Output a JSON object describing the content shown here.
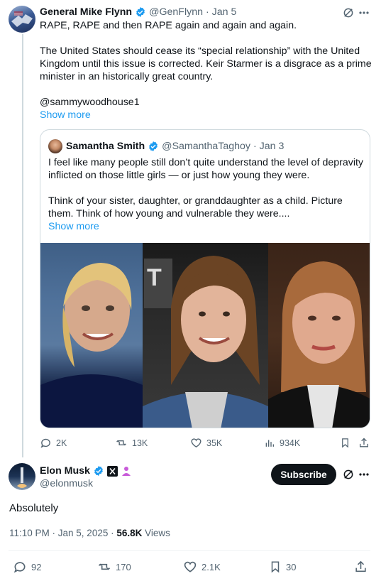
{
  "tweet1": {
    "name": "General Mike Flynn",
    "handle": "@GenFlynn",
    "time": "· Jan 5",
    "line1": "RAPE, RAPE and then RAPE again and again and again.",
    "line2": "The United States should cease its “special relationship” with the United",
    "line3": "Kingdom until this issue is corrected. Keir Starmer is a disgrace as a prime",
    "line4": "minister in an historically great country.",
    "mention": "@sammywoodhouse1",
    "show_more": "Show more"
  },
  "quote": {
    "name": "Samantha Smith",
    "handle": "@SamanthaTaghoy",
    "time": "· Jan 3",
    "line1": "I feel like many people still don’t quite understand the level of depravity",
    "line2": "inflicted on those little girls — or just how young they were.",
    "line3": "Think of your sister, daughter, or granddaughter as a child. Picture",
    "line4": "them. Think of how young and vulnerable they were....",
    "show_more": "Show more"
  },
  "actions1": {
    "replies": "2K",
    "reposts": "13K",
    "likes": "35K",
    "views": "934K"
  },
  "tweet2": {
    "name": "Elon Musk",
    "handle": "@elonmusk",
    "subscribe": "Subscribe",
    "body": "Absolutely",
    "timestamp": "11:10 PM · Jan 5, 2025 ·",
    "views_count": "56.8K",
    "views_label": "Views"
  },
  "actions2": {
    "replies": "92",
    "reposts": "170",
    "likes": "2.1K",
    "bookmarks": "30"
  },
  "colors": {
    "accent": "#1d9bf0",
    "verified": "#1d9bf0",
    "text": "#0f1419",
    "muted": "#536471",
    "border": "#cfd9de"
  }
}
